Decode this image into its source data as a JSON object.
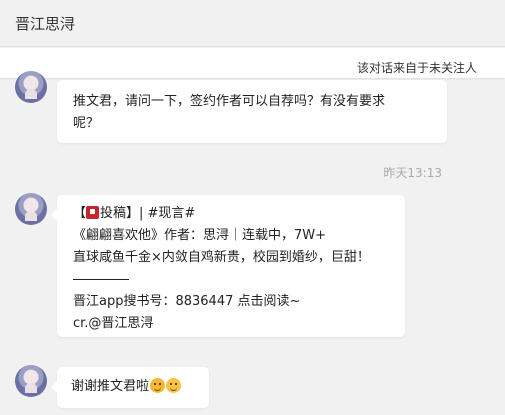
{
  "header": {
    "title": "晋江思浔"
  },
  "notice": {
    "text": "该对话来自于未关注人"
  },
  "messages": [
    {
      "text": "推文君，请问一下，签约作者可以自荐吗？有没有要求呢？",
      "lines": [
        "推文君，请问一下，签约作者可以自荐吗？有没有要求",
        "呢？"
      ]
    },
    {
      "timestamp": "昨天13:13"
    },
    {
      "lines": {
        "l1_prefix": "【",
        "l1_tag": "投稿】| #现言#",
        "l2": "《翩翩喜欢他》作者：思浔｜连载中，7W+",
        "l3": "直球咸鱼千金×内敛自鸡新贵，校园到婚纱，巨甜！",
        "l5": "晋江app搜书号：8836447 点击阅读~",
        "l6": "cr.@晋江思浔"
      },
      "icon": "red-tag-icon"
    },
    {
      "text": "谢谢推文君啦",
      "emojis": [
        "surprised-face-emoji",
        "grinning-face-emoji"
      ]
    }
  ]
}
